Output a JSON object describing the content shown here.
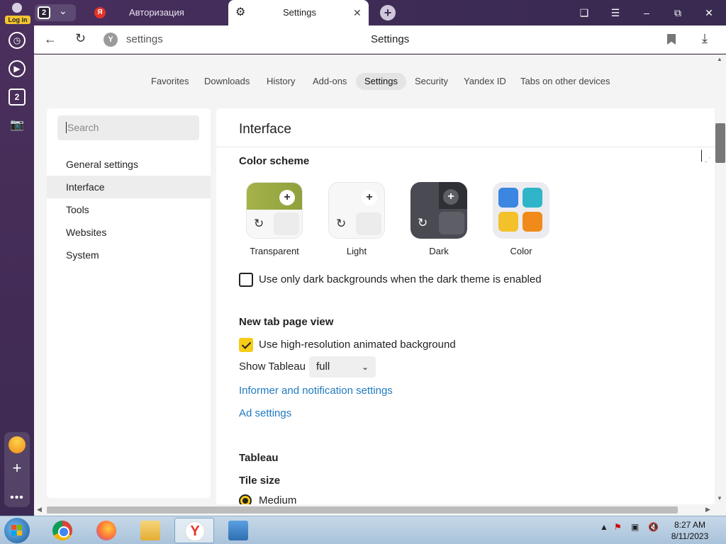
{
  "titlebar": {
    "profile_label": "Log in",
    "tab_count": "2",
    "tabs": [
      {
        "title": "Авторизация",
        "favicon": "Я"
      },
      {
        "title": "Settings"
      }
    ]
  },
  "sidebar": {
    "tab_count": "2"
  },
  "address": {
    "url": "settings",
    "page_title": "Settings",
    "site_badge": "Y"
  },
  "topnav": [
    "Favorites",
    "Downloads",
    "History",
    "Add-ons",
    "Settings",
    "Security",
    "Yandex ID",
    "Tabs on other devices"
  ],
  "left_panel": {
    "search_placeholder": "Search",
    "items": [
      "General settings",
      "Interface",
      "Tools",
      "Websites",
      "System"
    ],
    "active_index": 1
  },
  "interface": {
    "title": "Interface",
    "color_scheme": {
      "heading": "Color scheme",
      "themes": [
        "Transparent",
        "Light",
        "Dark",
        "Color"
      ]
    },
    "dark_bg_checkbox": {
      "label": "Use only dark backgrounds when the dark theme is enabled",
      "checked": false
    },
    "new_tab": {
      "heading": "New tab page view",
      "animated_bg": {
        "label": "Use high-resolution animated background",
        "checked": true
      },
      "show_tableau_label": "Show Tableau",
      "show_tableau_value": "full",
      "informer_link": "Informer and notification settings",
      "ad_link": "Ad settings"
    },
    "tableau": {
      "heading": "Tableau",
      "tile_size_heading": "Tile size",
      "tile_size_value": "Medium"
    }
  },
  "taskbar": {
    "time": "8:27 AM",
    "date": "8/11/2023",
    "yandex_glyph": "Y"
  },
  "colors": {
    "accent_yellow": "#f6cc18",
    "link_blue": "#1f7ac2",
    "titlebar": "#4a2f5e"
  }
}
